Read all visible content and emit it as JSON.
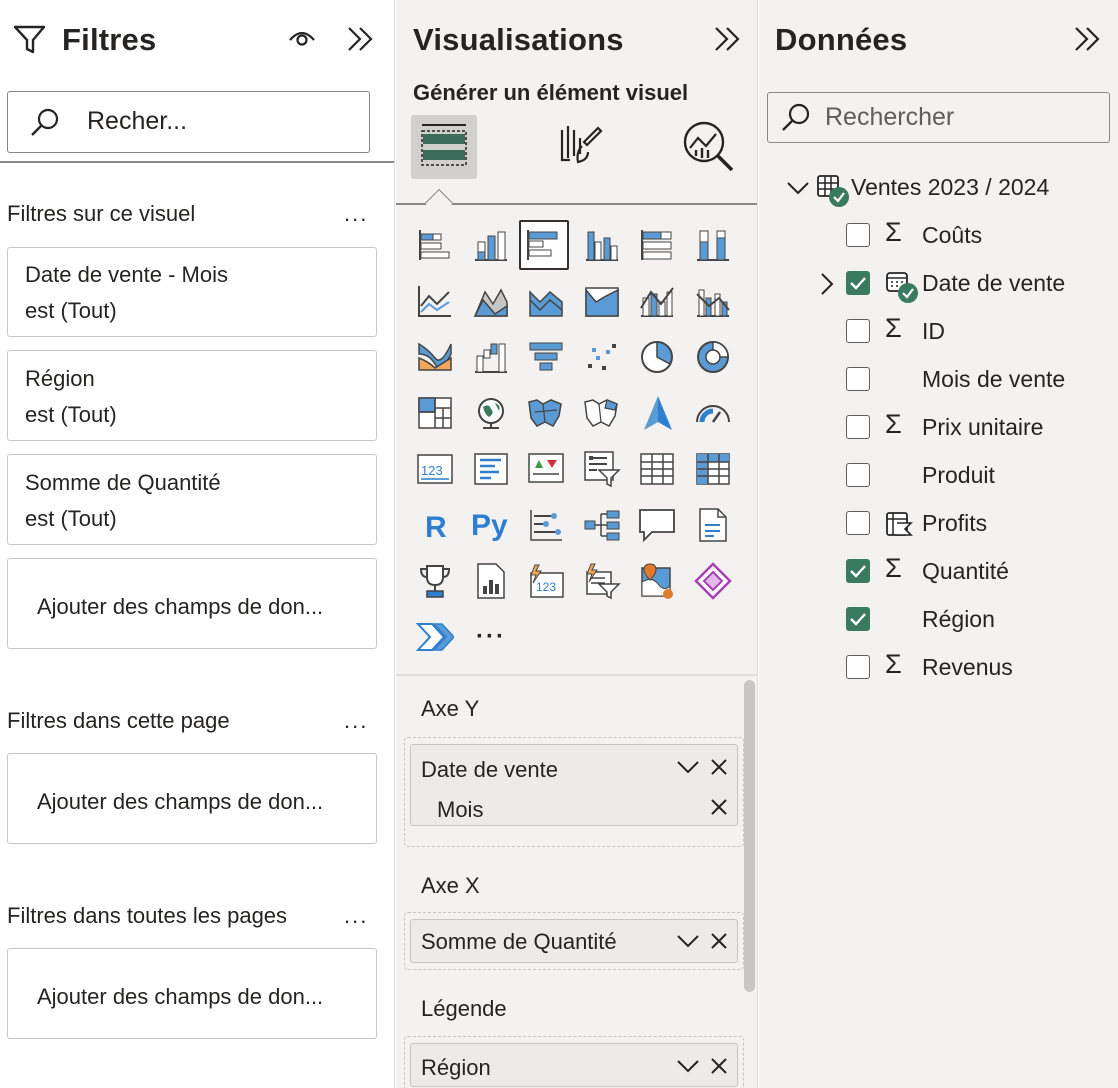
{
  "filters": {
    "title": "Filtres",
    "search_placeholder": "Recher...",
    "section_visual": "Filtres sur ce visuel",
    "section_page": "Filtres dans cette page",
    "section_all": "Filtres dans toutes les pages",
    "more": "...",
    "visual_cards": [
      {
        "name": "Date de vente - Mois",
        "state": "est (Tout)"
      },
      {
        "name": "Région",
        "state": "est (Tout)"
      },
      {
        "name": "Somme de Quantité",
        "state": "est (Tout)"
      }
    ],
    "add_fields": "Ajouter des champs de don..."
  },
  "visualisations": {
    "title": "Visualisations",
    "generate_label": "Générer un élément visuel",
    "more_visuals": "···",
    "wells": {
      "y_axis": {
        "label": "Axe Y",
        "field": "Date de vente",
        "sub": "Mois"
      },
      "x_axis": {
        "label": "Axe X",
        "field": "Somme de Quantité"
      },
      "legend": {
        "label": "Légende",
        "field": "Région"
      }
    }
  },
  "data": {
    "title": "Données",
    "search_placeholder": "Rechercher",
    "table_name": "Ventes 2023 / 2024",
    "fields": [
      {
        "name": "Coûts",
        "checked": false,
        "icon": "sigma"
      },
      {
        "name": "Date de vente",
        "checked": true,
        "icon": "calendar"
      },
      {
        "name": "ID",
        "checked": false,
        "icon": "sigma"
      },
      {
        "name": "Mois de vente",
        "checked": false,
        "icon": "none"
      },
      {
        "name": "Prix unitaire",
        "checked": false,
        "icon": "sigma"
      },
      {
        "name": "Produit",
        "checked": false,
        "icon": "none"
      },
      {
        "name": "Profits",
        "checked": false,
        "icon": "measure"
      },
      {
        "name": "Quantité",
        "checked": true,
        "icon": "sigma"
      },
      {
        "name": "Région",
        "checked": true,
        "icon": "none"
      },
      {
        "name": "Revenus",
        "checked": false,
        "icon": "sigma"
      }
    ]
  },
  "colors": {
    "accent_green": "#3a7a5e",
    "chart_blue": "#5b9bd5",
    "panel_bg": "#f3f2f1"
  }
}
